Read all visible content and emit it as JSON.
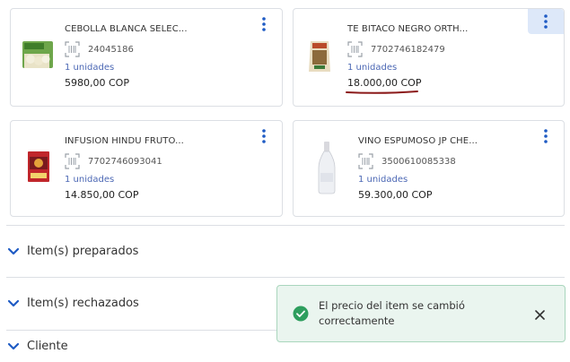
{
  "products": [
    {
      "name": "CEBOLLA BLANCA SELEC...",
      "code": "24045186",
      "quantity": "1 unidades",
      "price": "5980,00 COP"
    },
    {
      "name": "TE BITACO NEGRO ORTH...",
      "code": "7702746182479",
      "quantity": "1 unidades",
      "price": "18.000,00 COP"
    },
    {
      "name": "INFUSION HINDU FRUTO...",
      "code": "7702746093041",
      "quantity": "1 unidades",
      "price": "14.850,00 COP"
    },
    {
      "name": "VINO ESPUMOSO JP CHE...",
      "code": "3500610085338",
      "quantity": "1 unidades",
      "price": "59.300,00 COP"
    }
  ],
  "sections": [
    {
      "label": "Item(s) preparados"
    },
    {
      "label": "Item(s) rechazados"
    },
    {
      "label": "Cliente"
    }
  ],
  "toast": {
    "message": "El precio del item se cambió correctamente",
    "status_color": "#2e9e5e"
  },
  "colors": {
    "accent": "#1f5bc4",
    "quantity_text": "#4b67b4",
    "price_underline": "#8b1a1a"
  }
}
